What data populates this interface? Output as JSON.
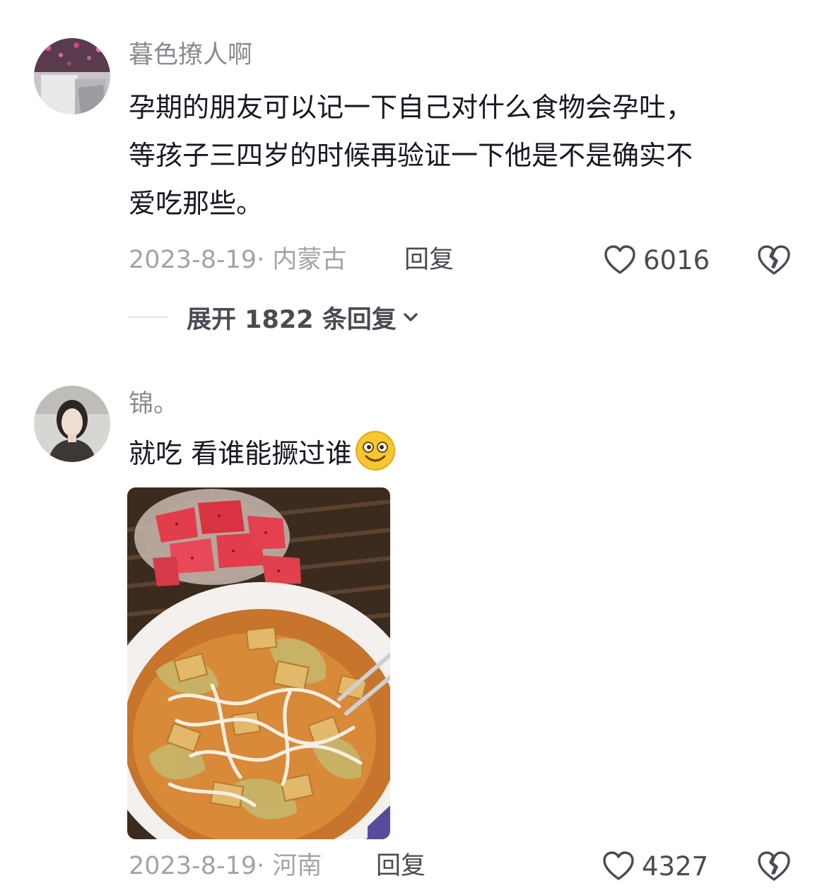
{
  "comments": [
    {
      "username": "暮色撩人啊",
      "text_lines": [
        "孕期的朋友可以记一下自己对什么食物会孕吐，",
        "等孩子三四岁的时候再验证一下他是不是确实不",
        "爱吃那些。"
      ],
      "date": "2023-8-19",
      "location": "· 内蒙古",
      "reply_label": "回复",
      "like_count": "6016",
      "expand_label": "展开 1822 条回复",
      "icons": [
        "heart-icon",
        "broken-heart-icon",
        "chevron-down-icon"
      ]
    },
    {
      "username": "锦。",
      "text": "就吃 看谁能撅过谁",
      "emoji": "smiling-emoji",
      "date": "2023-8-19",
      "location": "· 河南",
      "reply_label": "回复",
      "like_count": "4327",
      "image_description": "watermelon-and-noodle-soup-photo",
      "icons": [
        "heart-icon",
        "broken-heart-icon"
      ]
    }
  ],
  "colors": {
    "text_primary": "#161823",
    "text_secondary": "#8a8b91",
    "meta": "#a3a4a8",
    "action": "#4a4b52"
  }
}
